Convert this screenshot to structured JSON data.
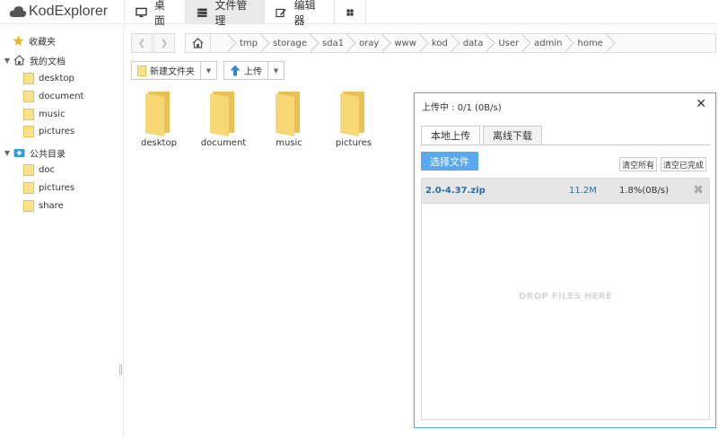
{
  "app": {
    "title": "KodExplorer"
  },
  "top_tabs": [
    {
      "label": "桌面",
      "icon": "monitor-icon"
    },
    {
      "label": "文件管理",
      "icon": "server-icon"
    },
    {
      "label": "编辑器",
      "icon": "edit-icon"
    },
    {
      "label": "",
      "icon": "grid-icon"
    }
  ],
  "sidebar": {
    "favorites_label": "收藏夹",
    "my_docs_label": "我的文档",
    "my_docs_items": [
      "desktop",
      "document",
      "music",
      "pictures"
    ],
    "public_label": "公共目录",
    "public_items": [
      "doc",
      "pictures",
      "share"
    ]
  },
  "breadcrumb": [
    "tmp",
    "storage",
    "sda1",
    "oray",
    "www",
    "kod",
    "data",
    "User",
    "admin",
    "home"
  ],
  "toolbar": {
    "new_folder": "新建文件夹",
    "upload": "上传"
  },
  "files": [
    "desktop",
    "document",
    "music",
    "pictures"
  ],
  "upload_dialog": {
    "title": "上传中 : 0/1 (0B/s)",
    "tab_local": "本地上传",
    "tab_offline": "离线下载",
    "choose_button": "选择文件",
    "clear_all": "清空所有",
    "clear_done": "清空已完成",
    "item": {
      "name": "2.0-4.37.zip",
      "size": "11.2M",
      "progress": "1.8%(0B/s)"
    },
    "drop_hint": "DROP FILES HERE"
  },
  "colors": {
    "accent": "#5aa9f0",
    "folder": "#f6d66b",
    "link": "#2e6da4"
  }
}
